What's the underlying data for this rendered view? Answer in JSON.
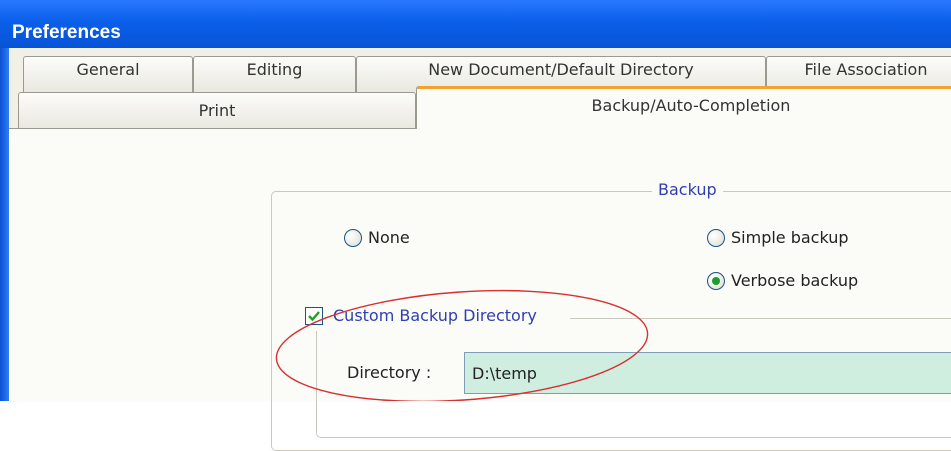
{
  "window": {
    "title": "Preferences"
  },
  "tabs_row1": [
    "General",
    "Editing",
    "New Document/Default Directory",
    "File Association"
  ],
  "tabs_row2": [
    "Print",
    "Backup/Auto-Completion"
  ],
  "backup": {
    "legend": "Backup",
    "options": [
      {
        "label": "None",
        "selected": false
      },
      {
        "label": "Simple backup",
        "selected": false
      },
      {
        "label": "Verbose backup",
        "selected": true
      }
    ]
  },
  "custom_dir": {
    "label": "Custom Backup Directory",
    "checked": true,
    "directory_label": "Directory :",
    "directory_value": "D:\\temp"
  },
  "colors": {
    "highlight_ellipse": "#d83030",
    "titlebar": "#0a5fe8",
    "tab_accent": "#f3a230"
  }
}
